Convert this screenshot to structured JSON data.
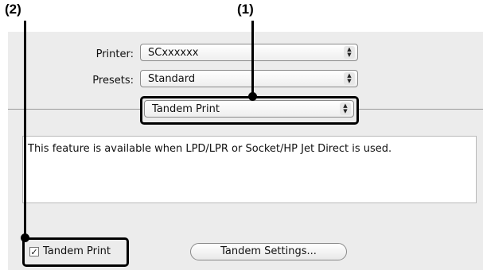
{
  "callouts": {
    "one": "(1)",
    "two": "(2)"
  },
  "printer": {
    "label": "Printer:",
    "value": "SCxxxxxx"
  },
  "presets": {
    "label": "Presets:",
    "value": "Standard"
  },
  "panel": {
    "value": "Tandem Print"
  },
  "description": "This feature is available when LPD/LPR or Socket/HP Jet Direct is used.",
  "tandem_checkbox": {
    "label": "Tandem Print",
    "checked": true
  },
  "tandem_settings_button": "Tandem Settings...",
  "colors": {
    "dialog_bg": "#ececec",
    "callout": "#000000"
  }
}
